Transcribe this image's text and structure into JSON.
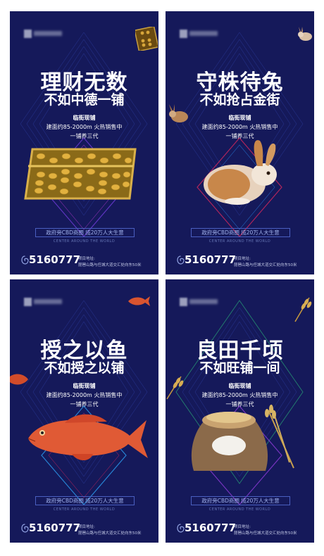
{
  "posters": [
    {
      "headline": "理财无数",
      "subline": "不如中德一铺",
      "details": [
        "临街现铺",
        "建面约85-2000m 火热销售中",
        "一铺养三代"
      ],
      "slogan": "政府旁CBD商圈 揽20万人大生意",
      "slogan_en": "CENTER AROUND THE WORLD",
      "phone": "5160777",
      "address_label": "项目地址:",
      "address": "琵琶山路与任城大道交汇处向东50米",
      "icon": "abacus-icon",
      "accent": "#6f3bd8"
    },
    {
      "headline": "守株待兔",
      "subline": "不如抢占金街",
      "details": [
        "临街现铺",
        "建面约85-2000m 火热销售中",
        "一铺养三代"
      ],
      "slogan": "政府旁CBD商圈 揽20万人大生意",
      "slogan_en": "CENTER AROUND THE WORLD",
      "phone": "5160777",
      "address_label": "项目地址:",
      "address": "琵琶山路与任城大道交汇处向东50米",
      "icon": "rabbit-icon",
      "accent": "#d6285d"
    },
    {
      "headline": "授之以鱼",
      "subline": "不如授之以铺",
      "details": [
        "临街现铺",
        "建面约85-2000m 火热销售中",
        "一铺养三代"
      ],
      "slogan": "政府旁CBD商圈 揽20万人大生意",
      "slogan_en": "CENTER AROUND THE WORLD",
      "phone": "5160777",
      "address_label": "项目地址:",
      "address": "琵琶山路与任城大道交汇处向东50米",
      "icon": "fish-icon",
      "accent": "#2c9cf0"
    },
    {
      "headline": "良田千顷",
      "subline": "不如旺铺一间",
      "details": [
        "临街现铺",
        "建面约85-2000m 火热销售中",
        "一铺养三代"
      ],
      "slogan": "政府旁CBD商圈 揽20万人大生意",
      "slogan_en": "CENTER AROUND THE WORLD",
      "phone": "5160777",
      "address_label": "项目地址:",
      "address": "琵琶山路与任城大道交汇处向东50米",
      "icon": "grain-sack-icon",
      "accent": "#27b36b"
    }
  ]
}
